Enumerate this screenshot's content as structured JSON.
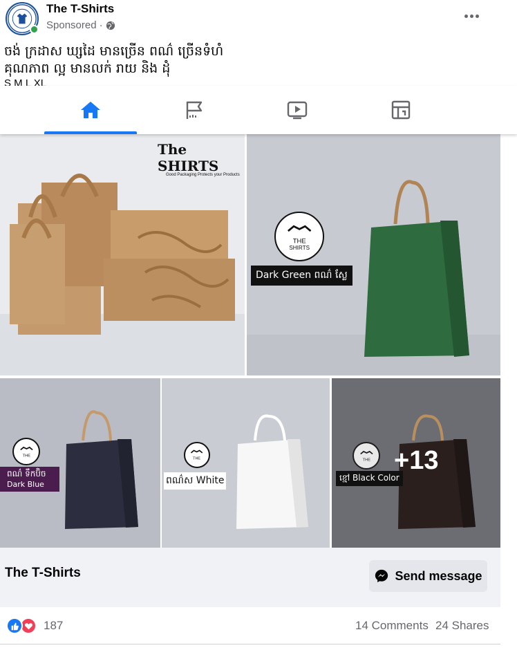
{
  "post": {
    "page_name": "The T-Shirts",
    "sponsored_label": "Sponsored",
    "separator": "·",
    "text_line1": "ចង់ ក្រដាស ឃ្សដៃ មានច្រើន ពណ៌ ច្រើនទំហំ",
    "text_line2": "គុណភាព ល្អ មានលក់ រាយ និង ដុំ",
    "text_line3_partial": "S M L XL"
  },
  "tabs": [
    {
      "name": "home",
      "icon": "home-icon",
      "active": true
    },
    {
      "name": "pages",
      "icon": "flag-icon",
      "active": false
    },
    {
      "name": "watch",
      "icon": "video-icon",
      "active": false
    },
    {
      "name": "marketplace",
      "icon": "store-icon",
      "active": false
    }
  ],
  "photos": {
    "brand_overlay": "The SHIRTS",
    "brand_tagline": "Good Packaging Protects your Products",
    "tile2_label": "Dark Green ពណ៌ ស្លែ",
    "tile3_label_line1": "ពណ៌ ទឹកប៊ិច",
    "tile3_label_line2": "Dark Blue",
    "tile4_label": "ពណ៌ស White",
    "tile5_label": "ខ្មៅ Black Color",
    "more_count": "+13"
  },
  "footer": {
    "page_name": "The T-Shirts",
    "send_message_label": "Send message",
    "reaction_count": "187",
    "comments": "14 Comments",
    "shares": "24 Shares"
  },
  "colors": {
    "accent": "#1877f2",
    "secondary_text": "#65676b",
    "like": "#1877f2",
    "love": "#f33e58",
    "kraft": "#c49a6c",
    "green_bag": "#2e6b3f",
    "navy_bag": "#2c2d3e",
    "black_bag": "#2a1f1c"
  }
}
